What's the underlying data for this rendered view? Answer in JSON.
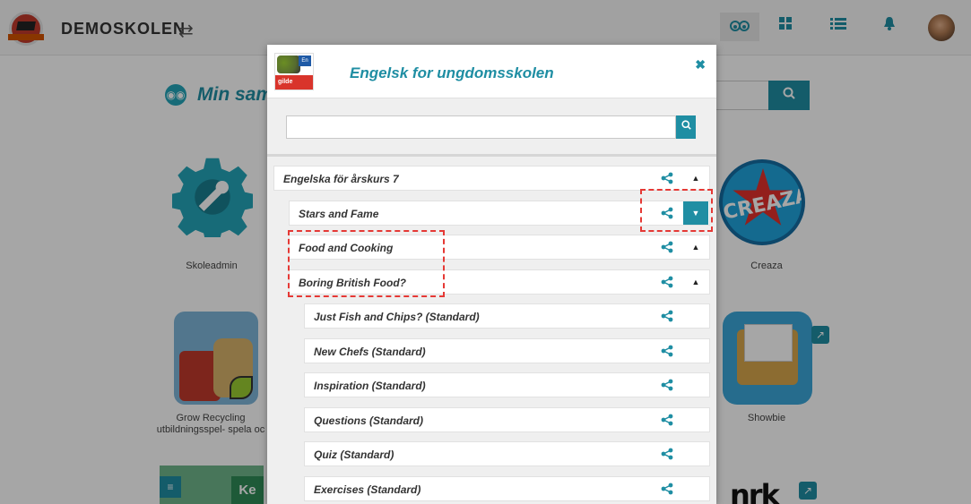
{
  "header": {
    "brand": "DEMOSKOLEN"
  },
  "main": {
    "heading": "Min sam"
  },
  "apps": [
    {
      "label": "Skoleadmin"
    },
    {
      "label": "Creaza",
      "logo_text": "CREAZA"
    },
    {
      "label": "Grow Recycling utbildningsspel- spela oc"
    },
    {
      "label": "Showbie"
    },
    {
      "label": "",
      "logo_text": "Ke"
    },
    {
      "label": "",
      "logo_text": "nrk"
    }
  ],
  "modal": {
    "title": "Engelsk for ungdomsskolen",
    "book_badge": "En",
    "book_brand": "gilde",
    "search": {
      "value": "",
      "placeholder": ""
    },
    "rows": [
      {
        "label": "Engelska för årskurs 7",
        "level": 0,
        "toggle": "collapse"
      },
      {
        "label": "Stars and Fame",
        "level": 1,
        "toggle": "expand-active"
      },
      {
        "label": "Food and Cooking",
        "level": 1,
        "toggle": "collapse"
      },
      {
        "label": "Boring British Food?",
        "level": 2,
        "toggle": "collapse"
      },
      {
        "label": "Just Fish and Chips? (Standard)",
        "level": 3,
        "toggle": "none"
      },
      {
        "label": "New Chefs (Standard)",
        "level": 3,
        "toggle": "none"
      },
      {
        "label": "Inspiration (Standard)",
        "level": 3,
        "toggle": "none"
      },
      {
        "label": "Questions (Standard)",
        "level": 3,
        "toggle": "none"
      },
      {
        "label": "Quiz (Standard)",
        "level": 3,
        "toggle": "none"
      },
      {
        "label": "Exercises (Standard)",
        "level": 3,
        "toggle": "none"
      }
    ]
  },
  "colors": {
    "accent": "#1f8ea3",
    "annotation": "#e53935"
  }
}
